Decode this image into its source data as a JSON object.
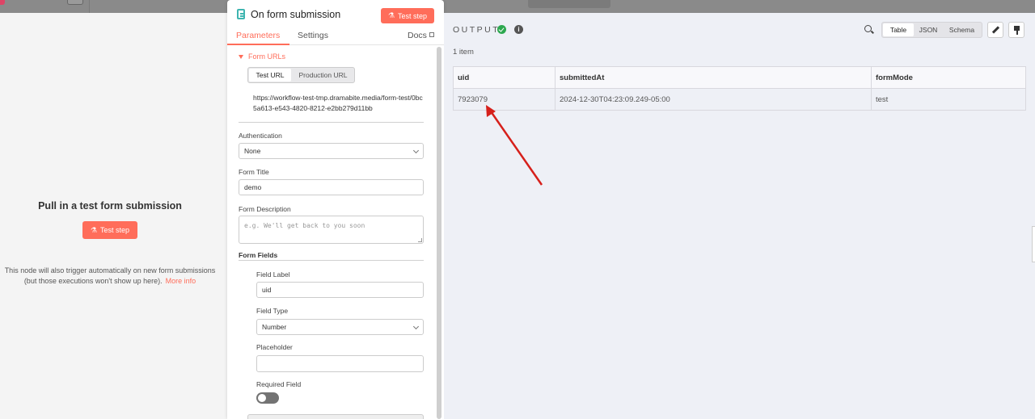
{
  "left_panel": {
    "title": "Pull in a test form submission",
    "test_button": "Test step",
    "note_line1": "This node will also trigger automatically on new form submissions",
    "note_line2": "(but those executions won't show up here).",
    "more_info": "More info"
  },
  "node": {
    "title": "On form submission",
    "test_button": "Test step",
    "tabs": {
      "parameters": "Parameters",
      "settings": "Settings",
      "docs": "Docs"
    },
    "form_urls_label": "Form URLs",
    "url_toggle": {
      "test": "Test URL",
      "production": "Production URL"
    },
    "url": "https://workflow-test-tmp.dramabite.media/form-test/0bc5a613-e543-4820-8212-e2bb279d11bb",
    "authentication": {
      "label": "Authentication",
      "value": "None"
    },
    "form_title": {
      "label": "Form Title",
      "value": "demo"
    },
    "form_description": {
      "label": "Form Description",
      "placeholder": "e.g. We'll get back to you soon"
    },
    "form_fields_label": "Form Fields",
    "field_label": {
      "label": "Field Label",
      "value": "uid"
    },
    "field_type": {
      "label": "Field Type",
      "value": "Number"
    },
    "placeholder": {
      "label": "Placeholder",
      "value": ""
    },
    "required_field": {
      "label": "Required Field",
      "enabled": false
    }
  },
  "output": {
    "title": "OUTPUT",
    "item_count": "1 item",
    "view_modes": {
      "table": "Table",
      "json": "JSON",
      "schema": "Schema"
    },
    "active_view": "Table",
    "columns": [
      "uid",
      "submittedAt",
      "formMode"
    ],
    "rows": [
      [
        "7923079",
        "2024-12-30T04:23:09.249-05:00",
        "test"
      ]
    ]
  },
  "colors": {
    "accent": "#ff6d5a",
    "success": "#2da84f",
    "annotation_arrow": "#d6201b"
  }
}
